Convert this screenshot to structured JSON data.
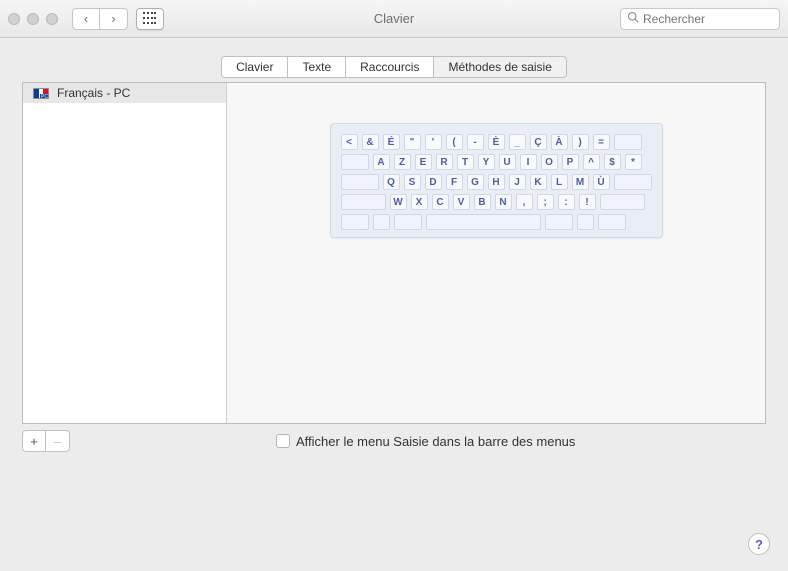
{
  "window": {
    "title": "Clavier"
  },
  "search": {
    "placeholder": "Rechercher"
  },
  "tabs": {
    "items": [
      {
        "label": "Clavier",
        "active": false
      },
      {
        "label": "Texte",
        "active": false
      },
      {
        "label": "Raccourcis",
        "active": false
      },
      {
        "label": "Méthodes de saisie",
        "active": true
      }
    ]
  },
  "sidebar": {
    "sources": [
      {
        "label": "Français - PC",
        "flag": "fr-pc"
      }
    ]
  },
  "keyboard": {
    "rows": [
      [
        "<",
        "&",
        "É",
        "\"",
        "'",
        "(",
        "-",
        "È",
        "_",
        "Ç",
        "À",
        ")",
        "="
      ],
      [
        "A",
        "Z",
        "E",
        "R",
        "T",
        "Y",
        "U",
        "I",
        "O",
        "P",
        "^",
        "$",
        "*"
      ],
      [
        "Q",
        "S",
        "D",
        "F",
        "G",
        "H",
        "J",
        "K",
        "L",
        "M",
        "Ù"
      ],
      [
        "W",
        "X",
        "C",
        "V",
        "B",
        "N",
        ",",
        ";",
        ":",
        "!"
      ]
    ]
  },
  "footer": {
    "add_label": "+",
    "remove_label": "–",
    "checkbox_label": "Afficher le menu Saisie dans la barre des menus"
  },
  "help": {
    "label": "?"
  }
}
